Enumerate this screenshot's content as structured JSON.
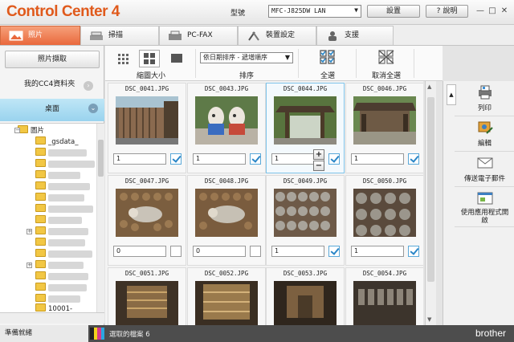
{
  "app": {
    "logo_main": "Control Center",
    "logo_num": "4",
    "model_label": "型號",
    "model_value": "MFC-J825DW LAN",
    "settings_label": "設置",
    "help_label": "說明",
    "help_q": "?"
  },
  "tabs": [
    {
      "label": "照片"
    },
    {
      "label": "掃描"
    },
    {
      "label": "PC-FAX"
    },
    {
      "label": "裝置設定"
    },
    {
      "label": "支援"
    }
  ],
  "left": {
    "photo_capture": "照片擷取",
    "cc4_folder": "我的CC4資料夾",
    "desktop": "桌面",
    "tree": {
      "pictures": "圖片",
      "gsdata": "_gsdata_",
      "last_item": "10001-"
    }
  },
  "toolbar": {
    "thumb_size_label": "縮圖大小",
    "sort_label": "排序",
    "sort_value": "依日期排序 - 遞增順序",
    "select_all": "全選",
    "deselect_all": "取消全選"
  },
  "photos": [
    {
      "name": "DSC_0041.JPG",
      "qty": "1",
      "checked": true
    },
    {
      "name": "DSC_0043.JPG",
      "qty": "1",
      "checked": true
    },
    {
      "name": "DSC_0044.JPG",
      "qty": "1",
      "checked": true
    },
    {
      "name": "DSC_0046.JPG",
      "qty": "1",
      "checked": true
    },
    {
      "name": "DSC_0047.JPG",
      "qty": "0",
      "checked": false
    },
    {
      "name": "DSC_0048.JPG",
      "qty": "0",
      "checked": false
    },
    {
      "name": "DSC_0049.JPG",
      "qty": "1",
      "checked": true
    },
    {
      "name": "DSC_0050.JPG",
      "qty": "1",
      "checked": true
    },
    {
      "name": "DSC_0051.JPG",
      "qty": "",
      "checked": false
    },
    {
      "name": "DSC_0052.JPG",
      "qty": "",
      "checked": false
    },
    {
      "name": "DSC_0053.JPG",
      "qty": "",
      "checked": false
    },
    {
      "name": "DSC_0054.JPG",
      "qty": "",
      "checked": false
    }
  ],
  "actions": [
    {
      "label": "列印",
      "icon": "print-icon"
    },
    {
      "label": "編輯",
      "icon": "edit-icon"
    },
    {
      "label": "傳送電子郵件",
      "icon": "email-icon"
    },
    {
      "label": "使用應用程式開啟",
      "icon": "open-with-app-icon"
    }
  ],
  "status": {
    "ready": "準備就緒",
    "selected_text": "選取的檔案 6",
    "brand": "brother"
  },
  "colors": {
    "accent_orange": "#e9683c",
    "selected_blue": "#99d3ee",
    "check_blue": "#2a86c7"
  }
}
